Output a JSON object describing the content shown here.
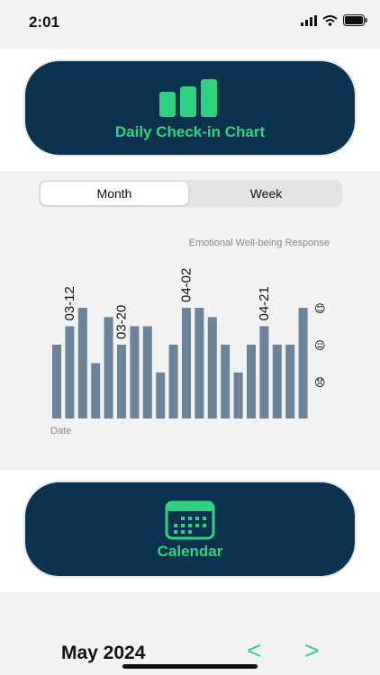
{
  "status": {
    "time": "2:01"
  },
  "hero": {
    "label": "Daily Check-in Chart"
  },
  "tabs": [
    {
      "label": "Month"
    },
    {
      "label": "Week"
    }
  ],
  "calendar_card": {
    "label": "Calendar"
  },
  "month_nav": {
    "title": "May 2024",
    "prev": "<",
    "next": ">"
  },
  "chart_data": {
    "type": "bar",
    "title": "Emotional Well-being Response",
    "xlabel": "Date",
    "ylim": [
      0,
      3
    ],
    "y_levels": [
      {
        "value": 1,
        "emoji": "😞"
      },
      {
        "value": 2,
        "emoji": "😐"
      },
      {
        "value": 3,
        "emoji": "😊"
      }
    ],
    "date_labels": [
      {
        "index": 1,
        "text": "03-12"
      },
      {
        "index": 5,
        "text": "03-20"
      },
      {
        "index": 10,
        "text": "04-02"
      },
      {
        "index": 16,
        "text": "04-21"
      }
    ],
    "values": [
      2,
      2.5,
      3,
      1.5,
      2.75,
      2,
      2.5,
      2.5,
      1.25,
      2,
      3,
      3,
      2.75,
      2,
      1.25,
      2,
      2.5,
      2,
      2,
      3
    ],
    "bar_color": "#6b8499"
  }
}
